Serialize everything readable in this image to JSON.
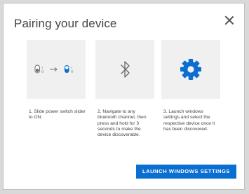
{
  "dialog": {
    "title": "Pairing your device",
    "close_icon": "close-icon"
  },
  "steps": [
    {
      "icon": "power-switch-slider-icon",
      "text": "1. Slide power switch slider to ON.",
      "switch_labels": {
        "on_mark": "I",
        "off_mark": "O"
      }
    },
    {
      "icon": "bluetooth-icon",
      "text": "2. Navigate to any bluetooth channel, then press and hold for 3 seconds to make the device discoverable."
    },
    {
      "icon": "gear-icon",
      "text": "3. Launch windows settings and select the respective device once it has been discovered."
    }
  ],
  "actions": {
    "launch_label": "LAUNCH WINDOWS SETTINGS"
  },
  "colors": {
    "accent": "#0a6fd1",
    "card_bg": "#f0f0f0",
    "text": "#444444"
  }
}
